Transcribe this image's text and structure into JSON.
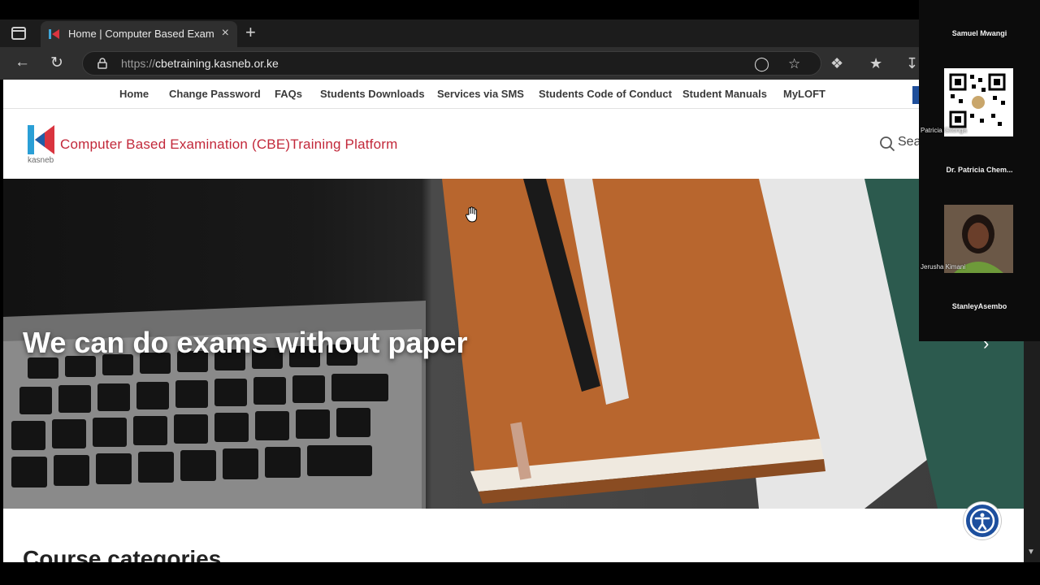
{
  "browser": {
    "tab_title": "Home | Computer Based Examinat",
    "tab_close": "×",
    "new_tab": "+",
    "url_proto": "https://",
    "url_host": "cbetraining.kasneb.or.ke"
  },
  "site": {
    "nav": [
      "Home",
      "Change Password",
      "FAQs",
      "Students Downloads",
      "Services via SMS",
      "Students Code of Conduct",
      "Student Manuals",
      "MyLOFT"
    ],
    "logo_text": "kasneb",
    "platform_title": "Computer Based Examination (CBE)Training Platform",
    "search_label": "Sea",
    "hero_caption": "We can do exams without paper",
    "slider_next": "›",
    "section_title": "Course categories"
  },
  "participants": {
    "p1": "Samuel Mwangi",
    "p2_overlay": "Patricia  Gitonga",
    "p3": "Dr. Patricia Chem...",
    "p4_overlay": "Jerusha Kimani",
    "p5": "StanleyAsembo"
  },
  "colors": {
    "accent_red": "#c2283a",
    "accent_blue": "#1d4f9e"
  }
}
